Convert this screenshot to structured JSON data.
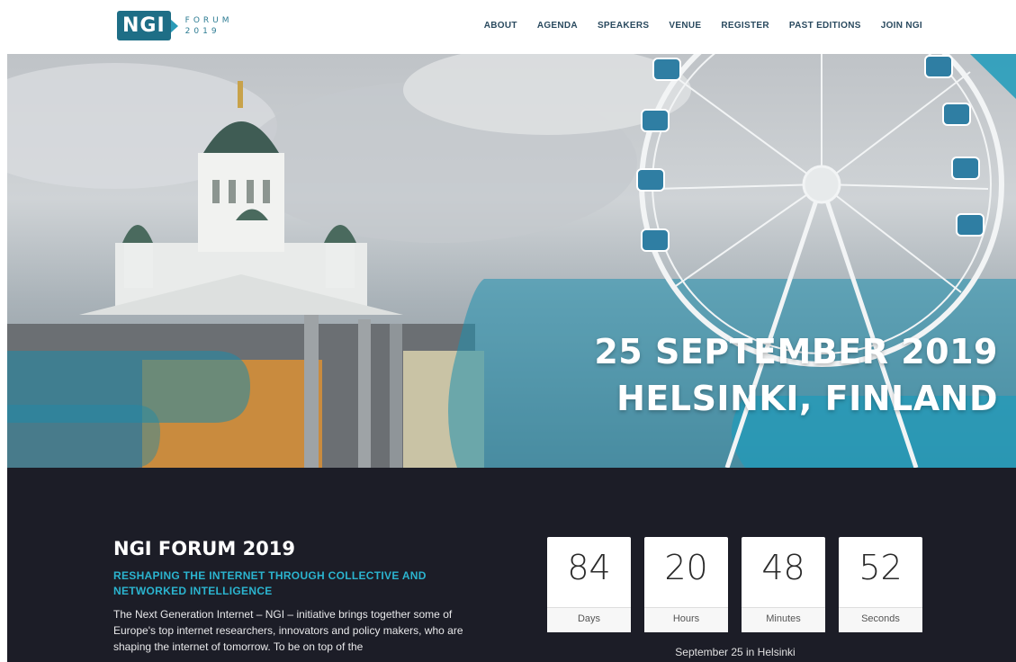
{
  "logo": {
    "mark": "NGI",
    "line1": "FORUM",
    "line2": "2019"
  },
  "nav": {
    "items": [
      "ABOUT",
      "AGENDA",
      "SPEAKERS",
      "VENUE",
      "REGISTER",
      "PAST EDITIONS",
      "JOIN NGI"
    ]
  },
  "hero": {
    "line1": "25 SEPTEMBER 2019",
    "line2": "HELSINKI, FINLAND"
  },
  "about": {
    "title": "NGI FORUM 2019",
    "subtitle": "RESHAPING THE INTERNET THROUGH COLLECTIVE AND NETWORKED INTELLIGENCE",
    "body": "The Next Generation Internet – NGI – initiative brings together some of Europe's top internet researchers, innovators and policy makers, who are shaping the internet of tomorrow. To be on top of the"
  },
  "countdown": {
    "days": {
      "value": "84",
      "label": "Days"
    },
    "hours": {
      "value": "20",
      "label": "Hours"
    },
    "minutes": {
      "value": "48",
      "label": "Minutes"
    },
    "seconds": {
      "value": "52",
      "label": "Seconds"
    },
    "caption": "September 25 in Helsinki"
  },
  "colors": {
    "brand": "#1e6e86",
    "accent": "#2bb4cf",
    "dark_bg": "#1c1d27"
  }
}
